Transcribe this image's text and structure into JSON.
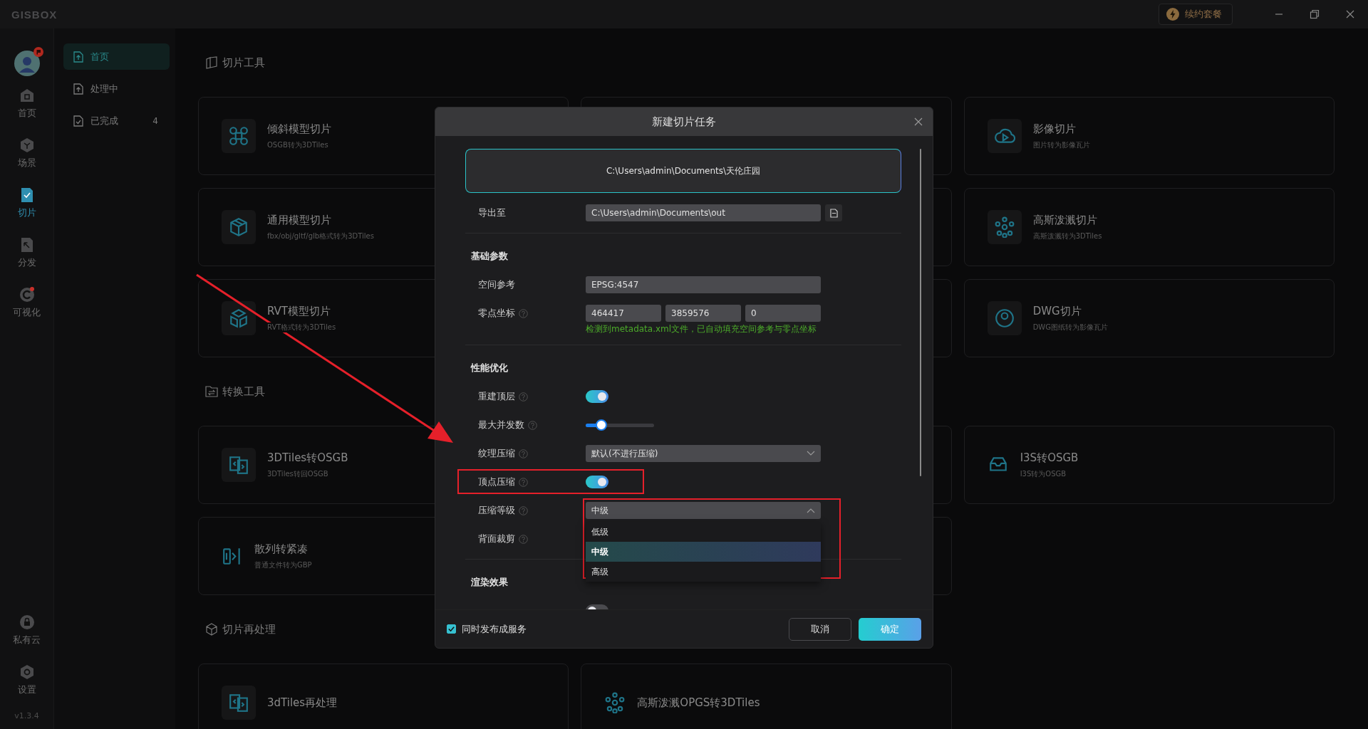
{
  "titlebar": {
    "logo": "GISBOX",
    "renew_button": "续约套餐"
  },
  "rail": {
    "items": [
      {
        "label": "首页",
        "selected": false,
        "badge": false
      },
      {
        "label": "场景",
        "selected": false,
        "badge": false
      },
      {
        "label": "切片",
        "selected": true,
        "badge": false
      },
      {
        "label": "分发",
        "selected": false,
        "badge": false
      },
      {
        "label": "可视化",
        "selected": false,
        "badge": true
      }
    ],
    "bottom_items": [
      {
        "label": "私有云"
      },
      {
        "label": "设置"
      }
    ],
    "version": "v1.3.4"
  },
  "sidebar": {
    "items": [
      {
        "label": "首页",
        "selected": true
      },
      {
        "label": "处理中",
        "selected": false
      },
      {
        "label": "已完成",
        "selected": false,
        "count": "4"
      }
    ]
  },
  "sections": [
    {
      "title": "切片工具",
      "cards": [
        {
          "kind": "card",
          "title": "倾斜模型切片",
          "subtitle": "OSGB转为3DTiles",
          "icon_tile": true
        },
        {
          "kind": "covered"
        },
        {
          "kind": "card",
          "title": "影像切片",
          "subtitle": "图片转为影像瓦片",
          "icon_tile": true
        },
        {
          "kind": "card",
          "title": "通用模型切片",
          "subtitle": "fbx/obj/gltf/glb格式转为3DTiles",
          "icon_tile": true
        },
        {
          "kind": "covered"
        },
        {
          "kind": "card",
          "title": "高斯泼溅切片",
          "subtitle": "高斯泼溅转为3DTiles",
          "icon_tile": true
        },
        {
          "kind": "card",
          "title": "RVT模型切片",
          "subtitle": "RVT格式转为3DTiles",
          "icon_tile": true
        },
        {
          "kind": "covered"
        },
        {
          "kind": "card",
          "title": "DWG切片",
          "subtitle": "DWG图纸转为影像瓦片",
          "icon_tile": true
        }
      ]
    },
    {
      "title": "转换工具",
      "cards": [
        {
          "kind": "card",
          "title": "3DTiles转OSGB",
          "subtitle": "3DTiles转回OSGB",
          "icon_tile": true
        },
        {
          "kind": "covered"
        },
        {
          "kind": "card",
          "title": "I3S转OSGB",
          "subtitle": "I3S转为OSGB",
          "icon_tile": false
        },
        {
          "kind": "card",
          "title": "散列转紧凑",
          "subtitle": "普通文件转为GBP",
          "icon_tile": false
        },
        {
          "kind": "covered"
        },
        {
          "kind": "empty"
        }
      ]
    },
    {
      "title": "切片再处理",
      "cards": [
        {
          "kind": "card",
          "title": "3dTiles再处理",
          "icon_tile": true
        },
        {
          "kind": "card",
          "title": "高斯泼溅OPGS转3DTiles",
          "icon_tile": false
        },
        {
          "kind": "empty"
        }
      ]
    }
  ],
  "dialog": {
    "title": "新建切片任务",
    "source_path": "C:\\Users\\admin\\Documents\\天伦庄园",
    "export": {
      "label": "导出至",
      "value": "C:\\Users\\admin\\Documents\\out"
    },
    "sections": [
      {
        "title": "基础参数",
        "rows": [
          {
            "kind": "input",
            "label": "空间参考",
            "help": false,
            "value": "EPSG:4547"
          },
          {
            "kind": "inputs",
            "label": "零点坐标",
            "help": true,
            "values": [
              "464417",
              "3859576",
              "0"
            ],
            "note": "检测到metadata.xml文件，已自动填充空间参考与零点坐标"
          }
        ]
      },
      {
        "title": "性能优化",
        "rows": [
          {
            "kind": "toggle",
            "label": "重建顶层",
            "help": true,
            "on": true
          },
          {
            "kind": "slider",
            "label": "最大并发数",
            "help": true,
            "level": 0.23
          },
          {
            "kind": "select",
            "label": "纹理压缩",
            "help": true,
            "value": "默认(不进行压缩)",
            "open": false
          },
          {
            "kind": "toggle",
            "label": "顶点压缩",
            "help": true,
            "on": true
          },
          {
            "kind": "select",
            "label": "压缩等级",
            "help": true,
            "value": "中级",
            "open": true,
            "options": [
              {
                "label": "低级",
                "selected": false
              },
              {
                "label": "中级",
                "selected": true
              },
              {
                "label": "高级",
                "selected": false
              }
            ]
          },
          {
            "kind": "covered",
            "label": "背面裁剪",
            "help": true
          }
        ]
      },
      {
        "title": "渲染效果",
        "rows": [
          {
            "kind": "toggle",
            "on": false
          }
        ]
      }
    ],
    "publish": {
      "label": "同时发布成服务",
      "checked": true
    },
    "buttons": [
      {
        "label": "取消",
        "kind": "secondary"
      },
      {
        "label": "确定",
        "kind": "primary"
      }
    ]
  }
}
